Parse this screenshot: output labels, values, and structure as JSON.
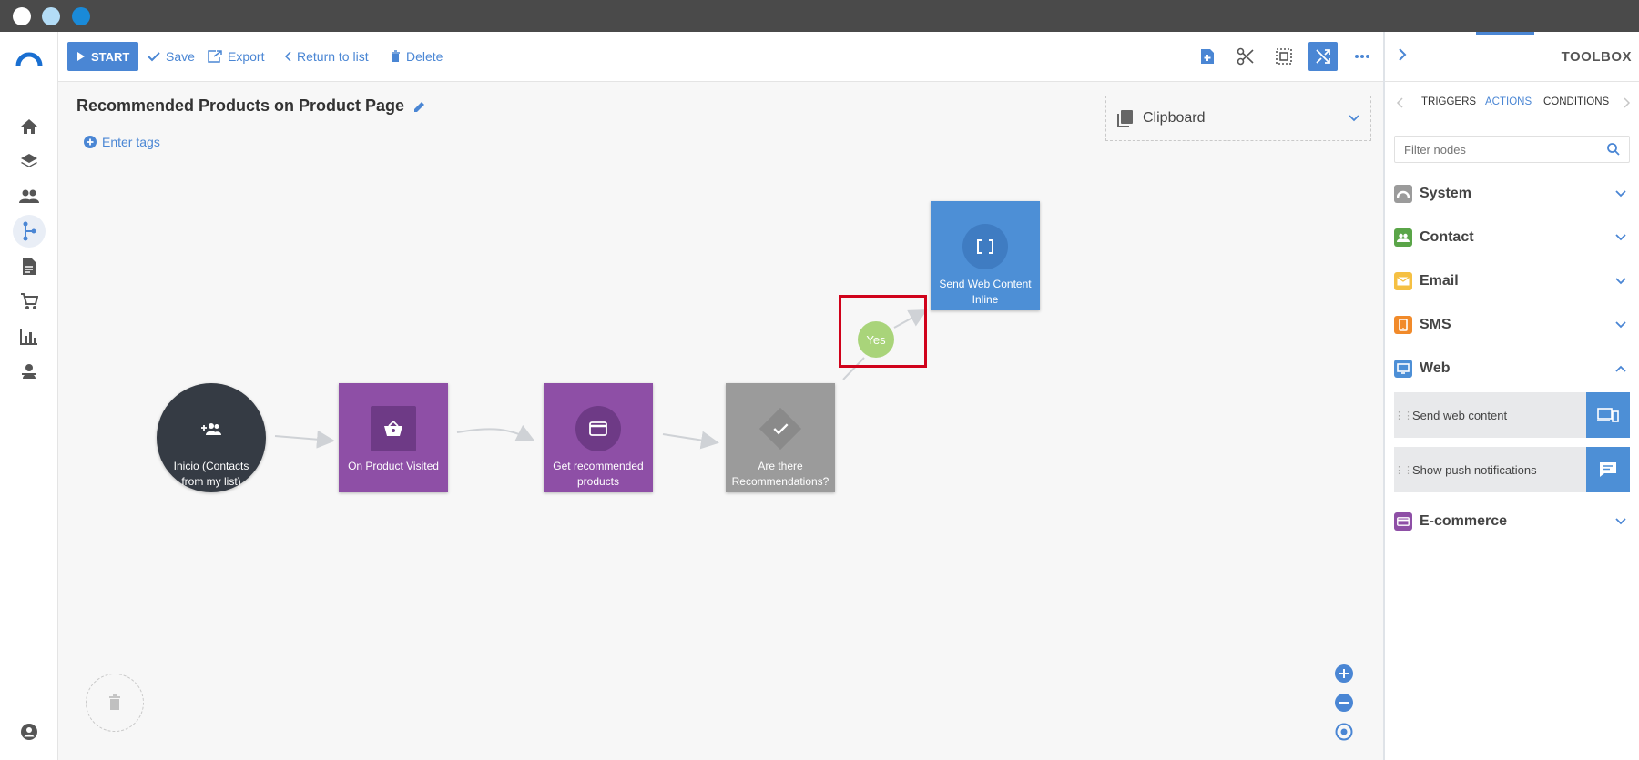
{
  "window": {
    "dots": [
      "#ffffff",
      "#b3dcf6",
      "#1a8ad8"
    ]
  },
  "toolbar": {
    "start_label": "START",
    "save_label": "Save",
    "export_label": "Export",
    "return_label": "Return to list",
    "delete_label": "Delete"
  },
  "page": {
    "title": "Recommended Products on Product Page",
    "tags_label": "Enter tags",
    "clipboard_label": "Clipboard"
  },
  "nodes": {
    "start_label": "Inicio (Contacts from my list)",
    "product_visited_label": "On Product Visited",
    "recommended_label": "Get recommended products",
    "condition_label": "Are there Recommendations?",
    "send_web_label": "Send Web Content Inline",
    "yes_label": "Yes"
  },
  "toolbox": {
    "title": "TOOLBOX",
    "tabs": [
      "TRIGGERS",
      "ACTIONS",
      "CONDITIONS"
    ],
    "active_tab": "ACTIONS",
    "filter_placeholder": "Filter nodes",
    "categories": [
      {
        "name": "System",
        "color": "#9b9b9b"
      },
      {
        "name": "Contact",
        "color": "#5aa548"
      },
      {
        "name": "Email",
        "color": "#f5c043"
      },
      {
        "name": "SMS",
        "color": "#f18a2a"
      },
      {
        "name": "Web",
        "color": "#4d8fd6"
      },
      {
        "name": "E-commerce",
        "color": "#8e4fa6"
      }
    ],
    "web_items": [
      {
        "label": "Send web content",
        "icon": "devices-icon"
      },
      {
        "label": "Show push notifications",
        "icon": "chat-icon"
      }
    ]
  },
  "colors": {
    "accent": "#4a86d4",
    "purple": "#8e4fa6",
    "condition_gray": "#9b9b9b",
    "yes_green": "#a9d47a",
    "highlight_red": "#d0021b"
  }
}
